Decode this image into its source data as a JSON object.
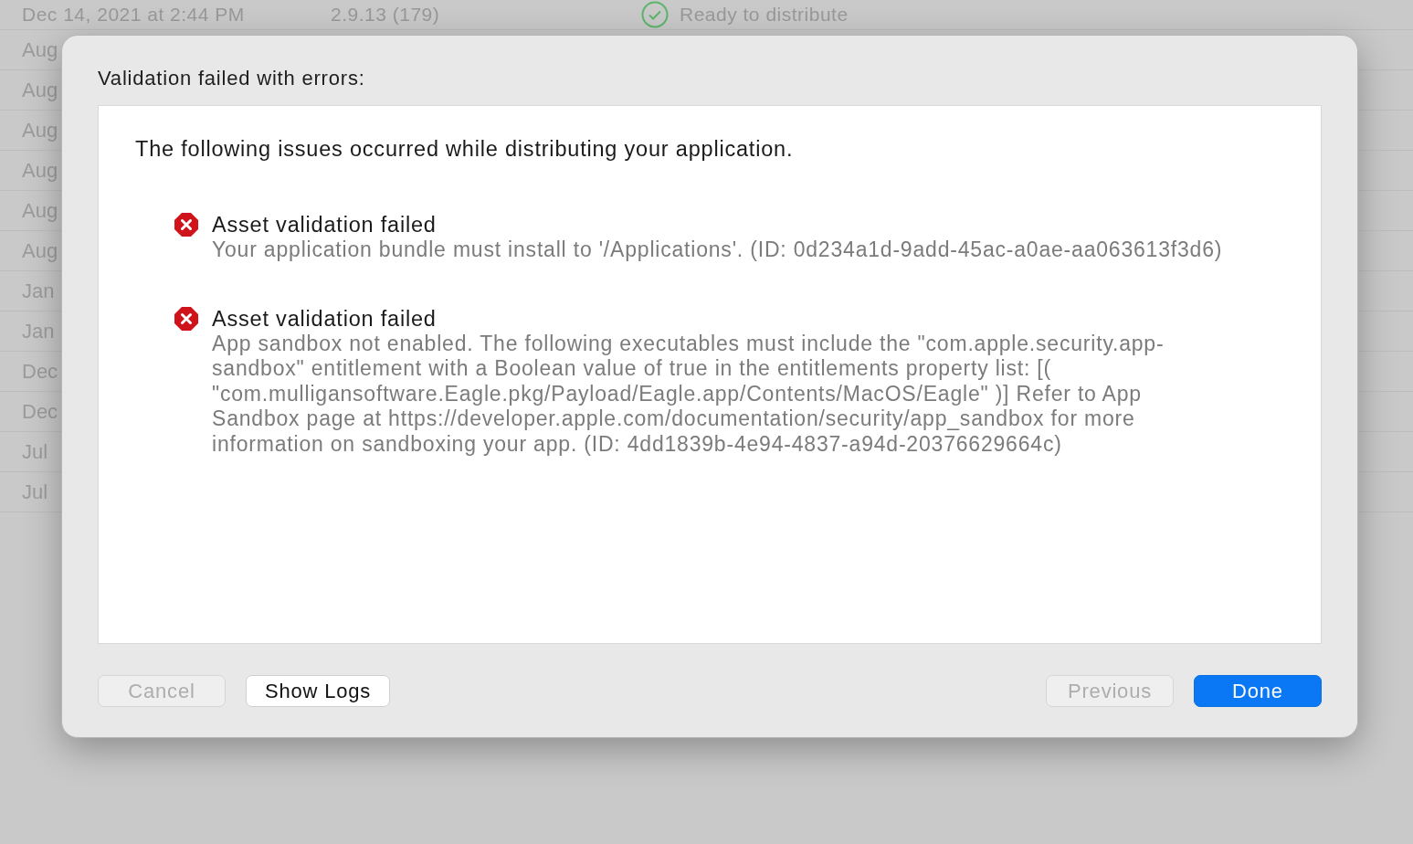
{
  "background_list": {
    "top_row": {
      "date": "Dec 14, 2021 at 2:44 PM",
      "version": "2.9.13 (179)",
      "status": "Ready to distribute"
    },
    "rows": [
      "Aug",
      "Aug",
      "Aug",
      "Aug",
      "Aug",
      "Aug",
      "Jan",
      "Jan",
      "Dec",
      "Dec",
      "Jul",
      "Jul"
    ]
  },
  "dialog": {
    "title": "Validation failed with errors:",
    "intro": "The following issues occurred while distributing your application.",
    "issues": [
      {
        "kind": "error",
        "title": "Asset validation failed",
        "detail": "Your application bundle must install to '/Applications'. (ID: 0d234a1d-9add-45ac-a0ae-aa063613f3d6)"
      },
      {
        "kind": "error",
        "title": "Asset validation failed",
        "detail": "App sandbox not enabled. The following executables must include the \"com.apple.security.app-sandbox\" entitlement with a Boolean value of true in the entitlements property list: [( \"com.mulligansoftware.Eagle.pkg/Payload/Eagle.app/Contents/MacOS/Eagle\" )] Refer to App Sandbox page at https://developer.apple.com/documentation/security/app_sandbox for more information on sandboxing your app. (ID: 4dd1839b-4e94-4837-a94d-20376629664c)"
      }
    ],
    "left_buttons": [
      {
        "label": "Cancel",
        "disabled": true,
        "default": false
      },
      {
        "label": "Show Logs",
        "disabled": false,
        "default": false
      }
    ],
    "right_buttons": [
      {
        "label": "Previous",
        "disabled": true,
        "default": false
      },
      {
        "label": "Done",
        "disabled": false,
        "default": true
      }
    ]
  }
}
